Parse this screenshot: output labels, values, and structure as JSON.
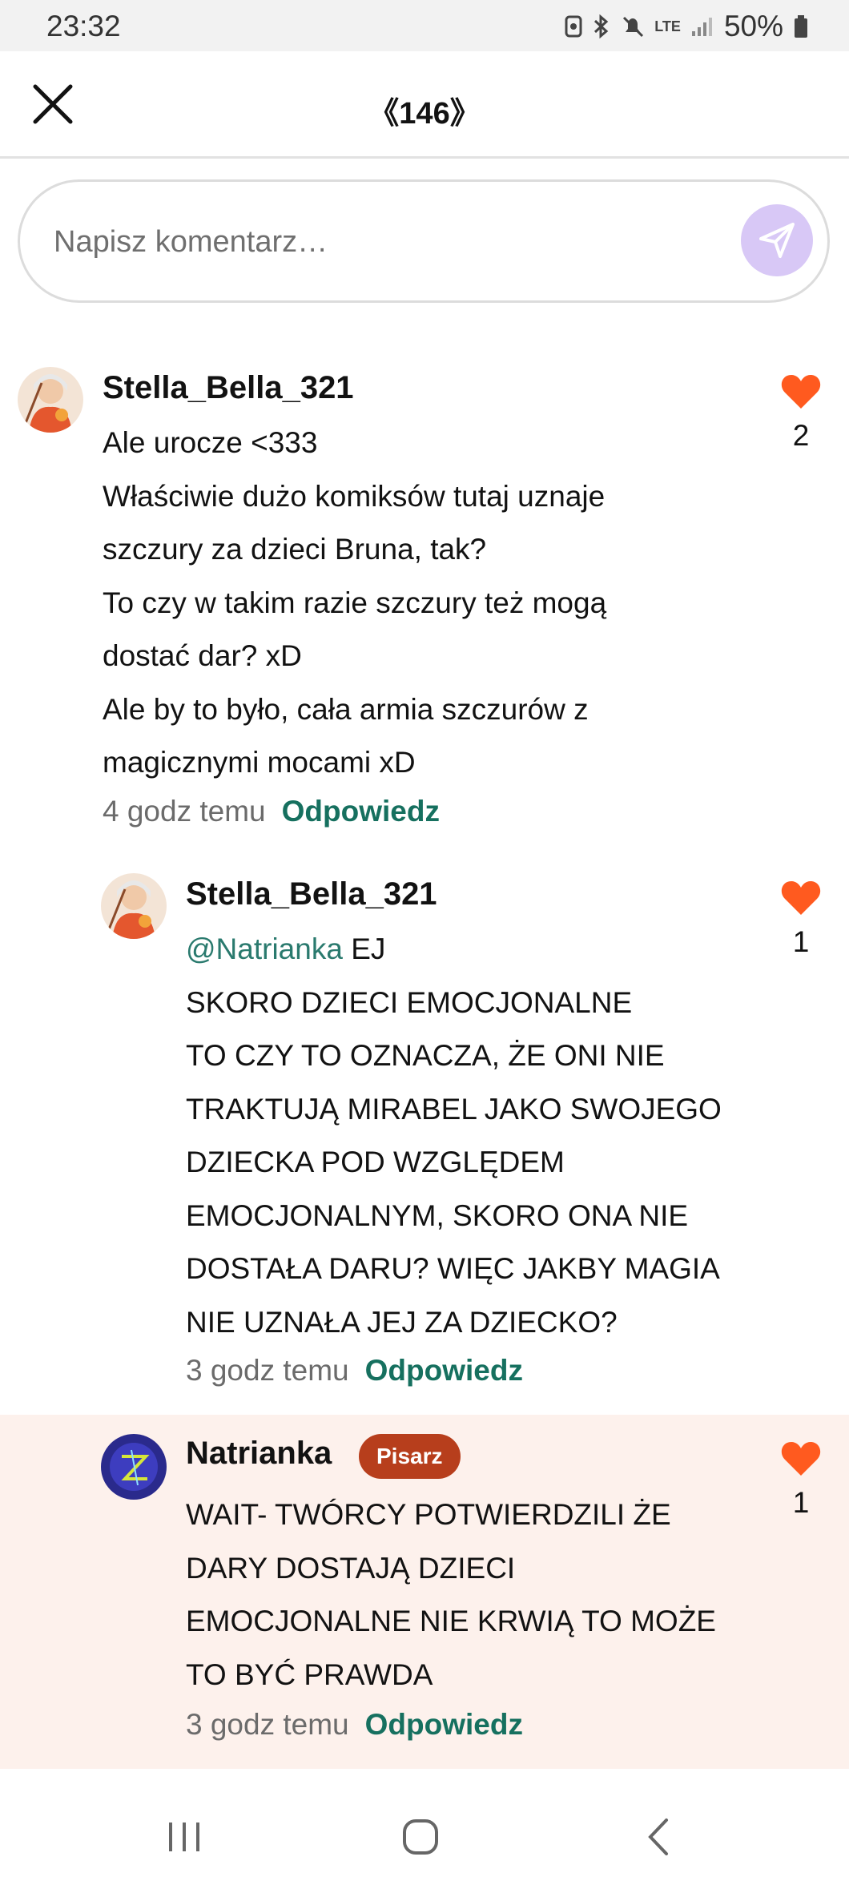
{
  "status_bar": {
    "time": "23:32",
    "network": "LTE",
    "battery": "50%"
  },
  "header": {
    "title": "《146》",
    "close_icon": "close-icon"
  },
  "comment_input": {
    "placeholder": "Napisz komentarz…",
    "value": "",
    "send_icon": "send-icon"
  },
  "comments": [
    {
      "username": "Stella_Bella_321",
      "lines": [
        "Ale urocze <333",
        "Właściwie dużo komiksów tutaj uznaje",
        "szczury za dzieci Bruna, tak?",
        "To czy w takim razie szczury też mogą",
        "dostać dar? xD",
        "Ale by to było, cała armia szczurów z",
        "magicznymi mocami xD"
      ],
      "time": "4 godz temu",
      "reply_label": "Odpowiedz",
      "likes": "2"
    },
    {
      "username": "Stella_Bella_321",
      "mention": "@Natrianka",
      "first_line_rest": " EJ",
      "lines": [
        "SKORO DZIECI EMOCJONALNE",
        "TO CZY TO OZNACZA, ŻE ONI NIE",
        "TRAKTUJĄ MIRABEL JAKO SWOJEGO",
        "DZIECKA POD WZGLĘDEM",
        "EMOCJONALNYM, SKORO ONA NIE",
        "DOSTAŁA DARU? WIĘC JAKBY MAGIA",
        "NIE UZNAŁA JEJ ZA DZIECKO?"
      ],
      "time": "3 godz temu",
      "reply_label": "Odpowiedz",
      "likes": "1"
    },
    {
      "username": "Natrianka",
      "badge": "Pisarz",
      "lines": [
        "WAIT- TWÓRCY POTWIERDZILI ŻE",
        "DARY DOSTAJĄ DZIECI",
        "EMOCJONALNE NIE KRWIĄ TO MOŻE",
        "TO BYĆ PRAWDA"
      ],
      "time": "3 godz temu",
      "reply_label": "Odpowiedz",
      "likes": "1"
    }
  ],
  "colors": {
    "accent_reply": "#16705f",
    "heart": "#ff5a1f",
    "badge": "#b73e1c",
    "highlight_bg": "#fdf1ec",
    "send_button": "#d8c8f6"
  }
}
